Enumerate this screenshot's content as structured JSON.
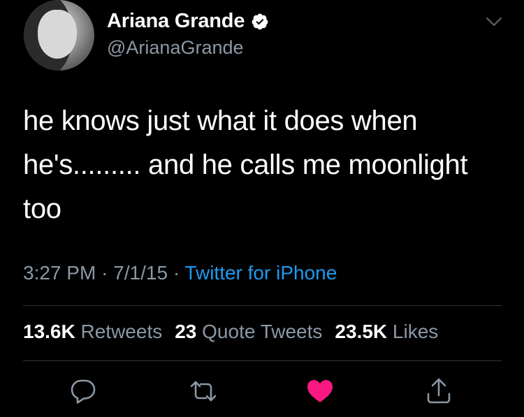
{
  "author": {
    "name": "Ariana Grande",
    "handle": "@ArianaGrande",
    "avatar_icon": "profile-photo",
    "verified_icon": "verified-badge-icon"
  },
  "tweet": {
    "lines": [
      "he knows just what it does when",
      "he's......... and he calls me moonlight",
      "too"
    ]
  },
  "meta": {
    "time": "3:27 PM",
    "separator": "·",
    "date": "7/1/15",
    "source": "Twitter for iPhone"
  },
  "stats": {
    "retweets_count": "13.6K",
    "retweets_label": "Retweets",
    "quotes_count": "23",
    "quotes_label": "Quote Tweets",
    "likes_count": "23.5K",
    "likes_label": "Likes"
  },
  "actions": {
    "icons": [
      "reply-icon",
      "retweet-icon",
      "like-icon",
      "share-icon"
    ]
  },
  "colors": {
    "background": "#000000",
    "text": "#ffffff",
    "secondary": "#8b98a5",
    "link": "#1d9bf0",
    "like": "#f91880",
    "divider": "#2f3336"
  }
}
